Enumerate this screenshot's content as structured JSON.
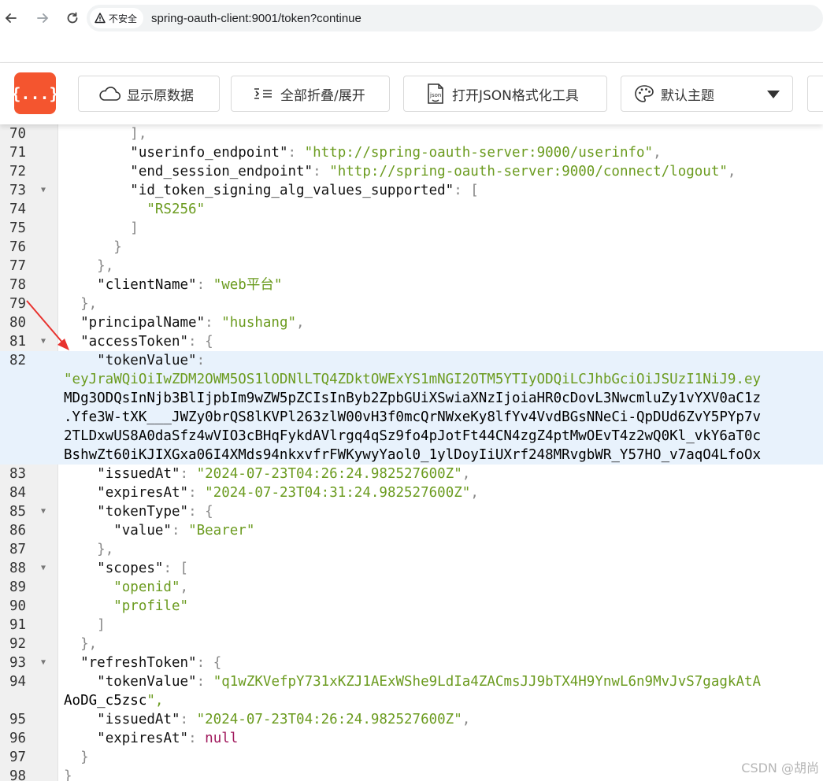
{
  "browser": {
    "security_label": "不安全",
    "url": "spring-oauth-client:9001/token?continue"
  },
  "toolbar": {
    "logo_text": "{...}",
    "show_raw_label": "显示原数据",
    "fold_label": "全部折叠/展开",
    "open_tool_label": "打开JSON格式化工具",
    "theme_label": "默认主题"
  },
  "code_lines": [
    {
      "num": "70",
      "fold": false,
      "text": "        ],"
    },
    {
      "num": "71",
      "fold": false,
      "text": "        \"userinfo_endpoint\": \"http://spring-oauth-server:9000/userinfo\","
    },
    {
      "num": "72",
      "fold": false,
      "text": "        \"end_session_endpoint\": \"http://spring-oauth-server:9000/connect/logout\","
    },
    {
      "num": "73",
      "fold": true,
      "text": "        \"id_token_signing_alg_values_supported\": ["
    },
    {
      "num": "74",
      "fold": false,
      "text": "          \"RS256\""
    },
    {
      "num": "75",
      "fold": false,
      "text": "        ]"
    },
    {
      "num": "76",
      "fold": false,
      "text": "      }"
    },
    {
      "num": "77",
      "fold": false,
      "text": "    },"
    },
    {
      "num": "78",
      "fold": false,
      "text": "    \"clientName\": \"web平台\""
    },
    {
      "num": "79",
      "fold": false,
      "text": "  },"
    },
    {
      "num": "80",
      "fold": false,
      "text": "  \"principalName\": \"hushang\","
    },
    {
      "num": "81",
      "fold": true,
      "text": "  \"accessToken\": {"
    },
    {
      "num": "82",
      "fold": false,
      "text": "    \"tokenValue\":"
    },
    {
      "num": "",
      "fold": false,
      "text": "\"eyJraWQiOiIwZDM2OWM5OS1lODNlLTQ4ZDktOWExYS1mNGI2OTM5YTIyODQiLCJhbGciOiJSUzI1NiJ9.ey"
    },
    {
      "num": "",
      "fold": false,
      "text": "MDg3ODQsInNjb3BlIjpbIm9wZW5pZCIsInByb2ZpbGUiXSwiaXNzIjoiaHR0cDovL3NwcmluZy1vYXV0aC1z"
    },
    {
      "num": "",
      "fold": false,
      "text": ".Yfe3W-tXK___JWZy0brQS8lKVPl263zlW00vH3f0mcQrNWxeKy8lfYv4VvdBGsNNeCi-QpDUd6ZvY5PYp7v"
    },
    {
      "num": "",
      "fold": false,
      "text": "2TLDxwUS8A0daSfz4wVIO3cBHqFykdAVlrgq4qSz9fo4pJotFt44CN4zgZ4ptMwOEvT4z2wQ0Kl_vkY6aT0c"
    },
    {
      "num": "",
      "fold": false,
      "text": "BshwZt60iKJIXGxa06I4XMds94nkxvfrFWKywyYaol0_1ylDoyIiUXrf248MRvgbWR_Y57HO_v7aqO4LfoOx"
    },
    {
      "num": "83",
      "fold": false,
      "text": "    \"issuedAt\": \"2024-07-23T04:26:24.982527600Z\","
    },
    {
      "num": "84",
      "fold": false,
      "text": "    \"expiresAt\": \"2024-07-23T04:31:24.982527600Z\","
    },
    {
      "num": "85",
      "fold": true,
      "text": "    \"tokenType\": {"
    },
    {
      "num": "86",
      "fold": false,
      "text": "      \"value\": \"Bearer\""
    },
    {
      "num": "87",
      "fold": false,
      "text": "    },"
    },
    {
      "num": "88",
      "fold": true,
      "text": "    \"scopes\": ["
    },
    {
      "num": "89",
      "fold": false,
      "text": "      \"openid\","
    },
    {
      "num": "90",
      "fold": false,
      "text": "      \"profile\""
    },
    {
      "num": "91",
      "fold": false,
      "text": "    ]"
    },
    {
      "num": "92",
      "fold": false,
      "text": "  },"
    },
    {
      "num": "93",
      "fold": true,
      "text": "  \"refreshToken\": {"
    },
    {
      "num": "94",
      "fold": false,
      "text": "    \"tokenValue\": \"q1wZKVefpY731xKZJ1AExWShe9LdIa4ZACmsJJ9bTX4H9YnwL6n9MvJvS7gagkAtA"
    },
    {
      "num": "",
      "fold": false,
      "text": "AoDG_c5zsc\","
    },
    {
      "num": "95",
      "fold": false,
      "text": "    \"issuedAt\": \"2024-07-23T04:26:24.982527600Z\","
    },
    {
      "num": "96",
      "fold": false,
      "text": "    \"expiresAt\": null"
    },
    {
      "num": "97",
      "fold": false,
      "text": "  }"
    },
    {
      "num": "98",
      "fold": false,
      "text": "}"
    }
  ],
  "highlight_rows": [
    12,
    13,
    14,
    15,
    16,
    17
  ],
  "watermark": "CSDN @胡尚",
  "colors": {
    "logo_bg": "#f4552f",
    "string": "#6b9b1f",
    "keyword_null": "#a0185c",
    "highlight": "#e8f2fc",
    "arrow": "#e8322e"
  }
}
